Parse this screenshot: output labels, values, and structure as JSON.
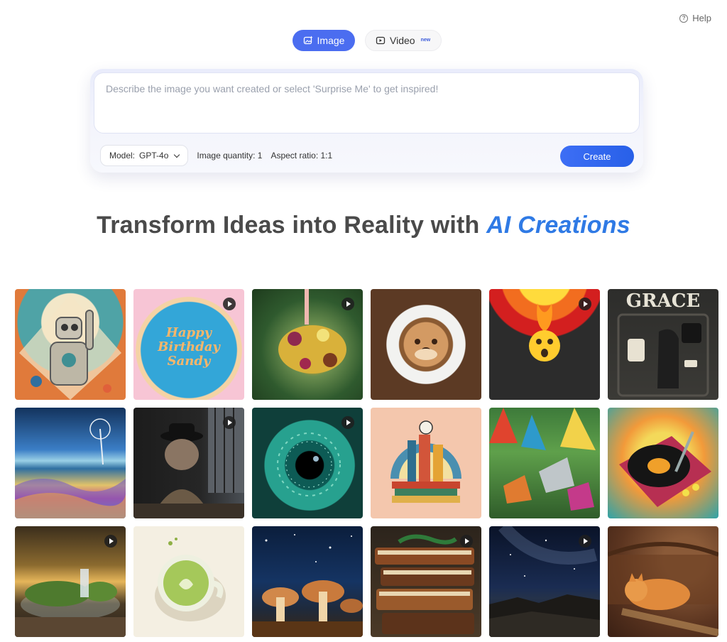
{
  "help": {
    "label": "Help"
  },
  "tabs": {
    "image": "Image",
    "video": "Video",
    "video_badge": "new"
  },
  "prompt": {
    "placeholder": "Describe the image you want created or select 'Surprise Me' to get inspired!"
  },
  "controls": {
    "model_label": "Model:",
    "model_value": "GPT-4o",
    "quantity": "Image quantity: 1",
    "aspect": "Aspect ratio: 1:1",
    "create": "Create"
  },
  "headline": {
    "main": "Transform Ideas into Reality with ",
    "accent": "AI Creations"
  },
  "gallery": {
    "cake_text": "Happy Birthday Sandy",
    "grace_text": "GRACE",
    "tiles": [
      {
        "name": "retro-robot",
        "video": false
      },
      {
        "name": "birthday-cake",
        "video": true
      },
      {
        "name": "flower-bee",
        "video": true
      },
      {
        "name": "otter-latte",
        "video": false
      },
      {
        "name": "shocked-emoji-fire",
        "video": true
      },
      {
        "name": "grace-dog-shelf",
        "video": false
      },
      {
        "name": "rainbow-dunes",
        "video": false
      },
      {
        "name": "bulldog-detective",
        "video": true
      },
      {
        "name": "green-eye",
        "video": true
      },
      {
        "name": "book-city",
        "video": false
      },
      {
        "name": "origami-jungle",
        "video": false
      },
      {
        "name": "pop-art-turntable",
        "video": false
      },
      {
        "name": "terrarium-waterfall",
        "video": true
      },
      {
        "name": "matcha-cup",
        "video": false
      },
      {
        "name": "mushroom-village",
        "video": false
      },
      {
        "name": "lizard-books",
        "video": true
      },
      {
        "name": "milky-way-cliff",
        "video": true
      },
      {
        "name": "sleeping-cat",
        "video": false
      }
    ]
  }
}
